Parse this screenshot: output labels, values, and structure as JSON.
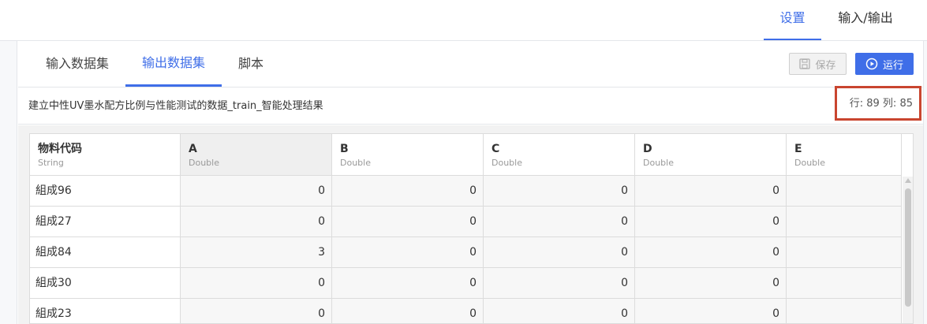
{
  "top_tabs": {
    "settings": "设置",
    "io": "输入/输出"
  },
  "sub_tabs": {
    "input": "输入数据集",
    "output": "输出数据集",
    "script": "脚本"
  },
  "toolbar": {
    "save_label": "保存",
    "run_label": "运行"
  },
  "dataset": {
    "title": "建立中性UV墨水配方比例与性能测试的数据_train_智能处理结果",
    "row_col_count": "行: 89 列: 85"
  },
  "table": {
    "columns": [
      {
        "name": "物料代码",
        "type": "String"
      },
      {
        "name": "A",
        "type": "Double"
      },
      {
        "name": "B",
        "type": "Double"
      },
      {
        "name": "C",
        "type": "Double"
      },
      {
        "name": "D",
        "type": "Double"
      },
      {
        "name": "E",
        "type": "Double"
      }
    ],
    "rows": [
      [
        "組成96",
        "0",
        "0",
        "0",
        "0",
        ""
      ],
      [
        "組成27",
        "0",
        "0",
        "0",
        "0",
        ""
      ],
      [
        "組成84",
        "3",
        "0",
        "0",
        "0",
        ""
      ],
      [
        "組成30",
        "0",
        "0",
        "0",
        "0",
        ""
      ],
      [
        "組成23",
        "0",
        "0",
        "0",
        "0",
        ""
      ]
    ]
  },
  "colors": {
    "accent": "#3f6ee8",
    "highlight_box": "#c9452f"
  },
  "icons": {
    "save": "floppy-disk-icon",
    "run": "play-circle-icon"
  }
}
